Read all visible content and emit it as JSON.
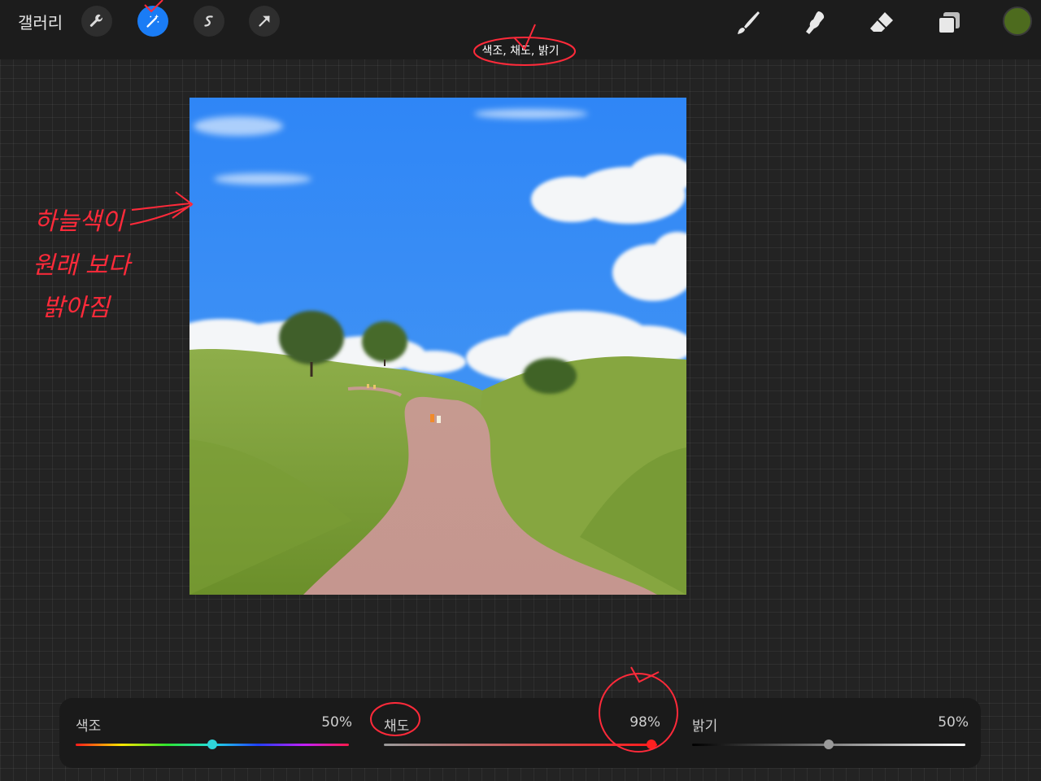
{
  "topbar": {
    "gallery_label": "갤러리",
    "left_tools": [
      {
        "name": "wrench-icon",
        "active": false
      },
      {
        "name": "magic-wand-icon",
        "active": true
      },
      {
        "name": "selection-icon",
        "active": false
      },
      {
        "name": "transform-arrow-icon",
        "active": false
      }
    ],
    "right_tools": [
      {
        "name": "brush-icon"
      },
      {
        "name": "smudge-icon"
      },
      {
        "name": "eraser-icon"
      },
      {
        "name": "layers-icon"
      }
    ],
    "current_color": "#4d6b1e",
    "mode_label": "색조, 채도, 밝기"
  },
  "sliders": {
    "hue": {
      "label": "색조",
      "value": "50%",
      "fraction": 0.5,
      "knob_color": "#2fd6d9"
    },
    "saturation": {
      "label": "채도",
      "value": "98%",
      "fraction": 0.98,
      "knob_color": "#ff2020"
    },
    "brightness": {
      "label": "밝기",
      "value": "50%",
      "fraction": 0.5,
      "knob_color": "#9a9a9a"
    }
  },
  "annotation": {
    "handwritten_note": [
      "하늘색이",
      "원래 보다",
      "밝아짐"
    ],
    "color": "#ff2a3a"
  }
}
